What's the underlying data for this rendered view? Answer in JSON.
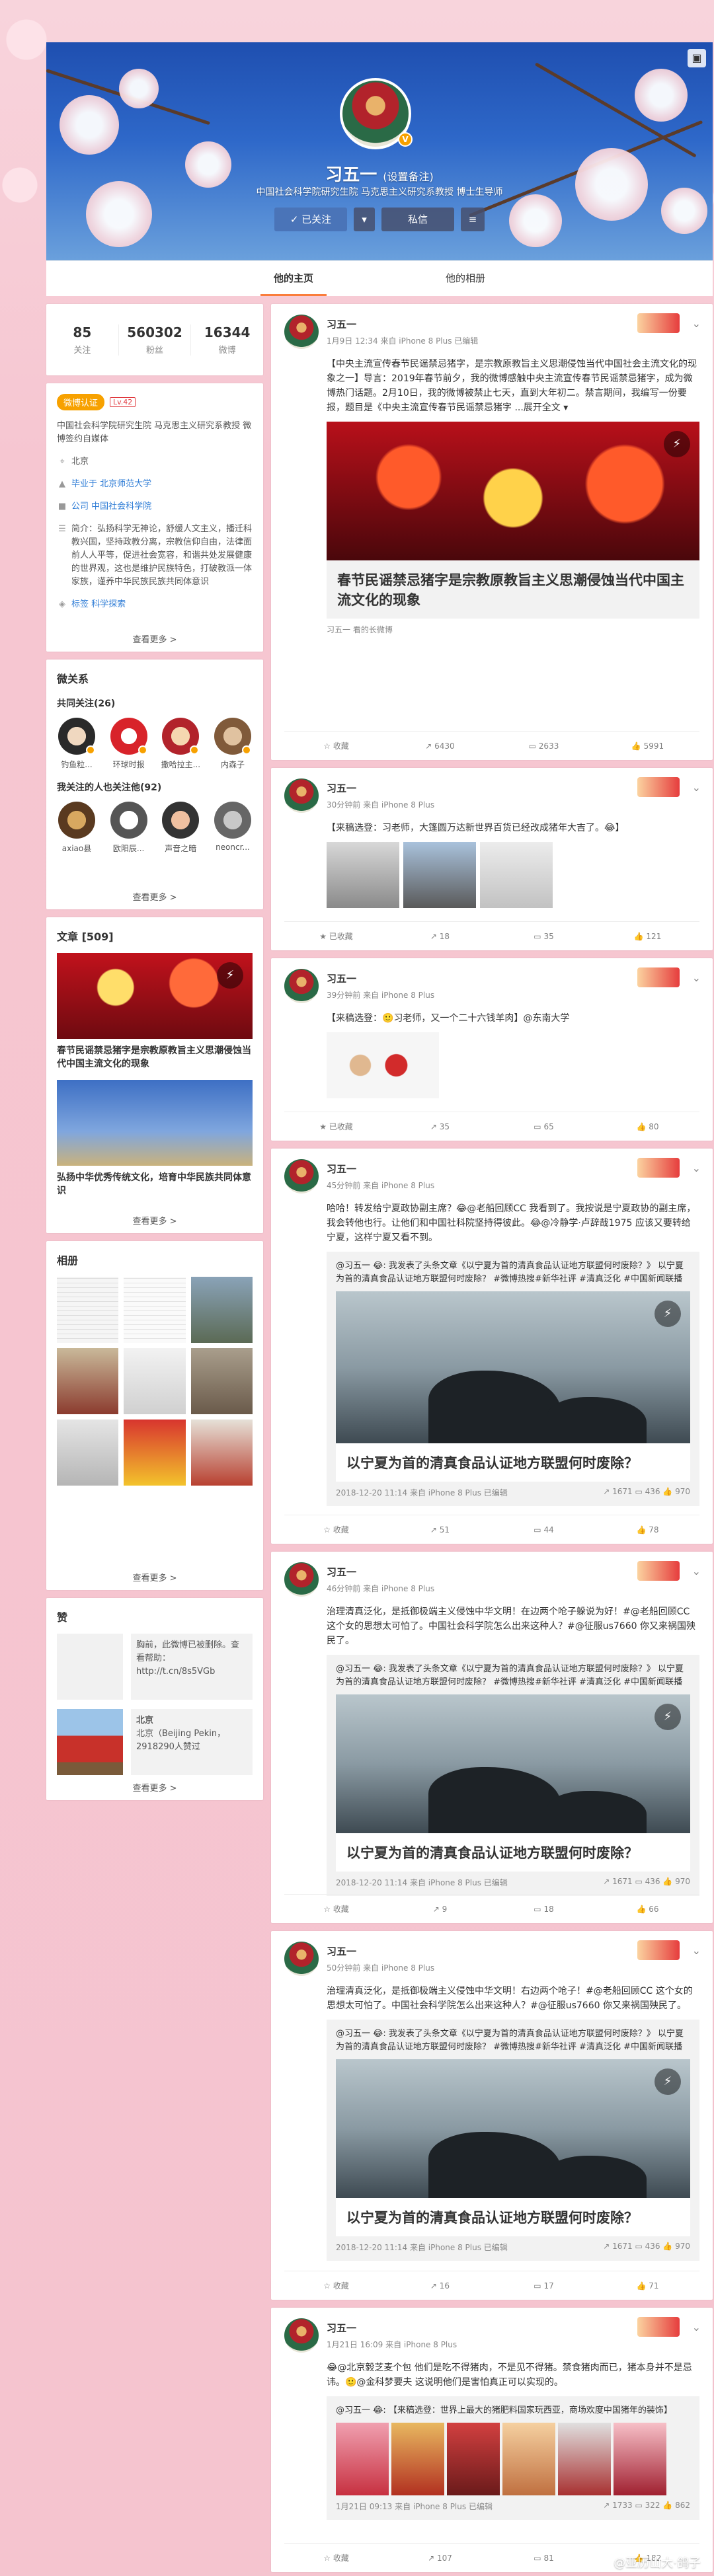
{
  "profile": {
    "name": "习五一",
    "note": "(设置备注)",
    "desc": "中国社会科学院研究生院 马克思主义研究系教授 博士生导师",
    "follow_btn": "已关注",
    "msg_btn": "私信"
  },
  "tabs": [
    "他的主页",
    "他的相册"
  ],
  "stats": [
    {
      "num": "85",
      "label": "关注"
    },
    {
      "num": "560302",
      "label": "粉丝"
    },
    {
      "num": "16344",
      "label": "微博"
    }
  ],
  "info": {
    "vtag": "微博认证",
    "lv": "Lv.42",
    "verify": "中国社会科学院研究生院 马克思主义研究系教授 微博签约自媒体",
    "location": "北京",
    "school": "毕业于 北京师范大学",
    "company": "公司 中国社会科学院",
    "intro": "简介：弘扬科学无神论，舒缓人文主义，播迁科教兴国，坚持政教分离，宗教信仰自由，法律面前人人平等，促进社会宽容，和谐共处发展健康的世界观，这也是维护民族特色，打破教派一体家族，谨养中华民族民族共同体意识",
    "tags": "标签 科学探索",
    "more": "查看更多 >"
  },
  "relations": {
    "title": "微关系",
    "follow_title": "共同关注(26)",
    "follow": [
      "钓鱼粒...",
      "环球时报",
      "撒哈拉主...",
      "内森子"
    ],
    "fans_title": "我关注的人也关注他(92)",
    "fans": [
      "axiao县",
      "欧阳辰...",
      "声音之暗",
      "neoncr..."
    ],
    "more": "查看更多 >"
  },
  "articles": {
    "title": "文章 [509]",
    "items": [
      "春节民谣禁忌猪字是宗教原教旨主义思潮侵蚀当代中国主流文化的现象",
      "弘扬中华优秀传统文化，培育中华民族共同体意识"
    ],
    "more": "查看更多 >"
  },
  "album": {
    "title": "相册",
    "more": "查看更多 >"
  },
  "zan": {
    "title": "赞",
    "item1": "胸前，此微博已被删除。查看帮助：http://t.cn/8s5VGb",
    "item2_title": "北京",
    "item2": "北京（Beijing Pekin，2918290人赞过",
    "more": "查看更多 >"
  },
  "posts": [
    {
      "name": "习五一",
      "meta": "1月9日 12:34 来自 iPhone 8 Plus  已编辑",
      "text": "【中央主流宣传春节民谣禁忌猪字，是宗教原教旨主义思潮侵蚀当代中国社会主流文化的现象之一】导言：2019年春节前夕，我的微博感触中央主流宣传春节民谣禁忌猪字，成为微博热门话题。2月10日，我的微博被禁止七天，直到大年初二。禁言期间，我编写一份要报，题目是《中央主流宣传春节民谣禁忌猪字 ...展开全文 ▾",
      "card_title": "春节民谣禁忌猪字是宗教原教旨主义思潮侵蚀当代中国主流文化的现象",
      "card_meta": "习五一 看的长微博",
      "actions": [
        "收藏",
        "6430",
        "2633",
        "5991"
      ]
    },
    {
      "name": "习五一",
      "meta": "30分钟前 来自 iPhone 8 Plus",
      "text": "【来稿选登：习老师，大篷圆万达新世界百货已经改成猪年大吉了。😂】",
      "actions": [
        "已收藏",
        "18",
        "35",
        "121"
      ]
    },
    {
      "name": "习五一",
      "meta": "39分钟前 来自 iPhone 8 Plus",
      "text": "【来稿选登：🙂习老师，又一个二十六钱羊肉】@东南大学",
      "actions": [
        "已收藏",
        "35",
        "65",
        "80"
      ]
    },
    {
      "name": "习五一",
      "meta": "45分钟前 来自 iPhone 8 Plus",
      "text": "哈哈！转发给宁夏政协副主席？😂@老船回顾CC 我看到了。我按说是宁夏政协的副主席，我会转他也行。让他们和中国社科院坚持得彼此。😂@冷静学·卢辞哉1975 应该又要转给宁夏，这样宁夏又看不到。",
      "fwd_text": "@习五一 😂: 我发表了头条文章《以宁夏为首的清真食品认证地方联盟何时废除？》 以宁夏为首的清真食品认证地方联盟何时废除？ #微博热搜#新华社评 #清真泛化 #中国新闻联播",
      "cap": "以宁夏为首的清真食品认证地方联盟何时废除？",
      "fmeta": "2018-12-20 11:14 来自 iPhone 8 Plus  已编辑",
      "fcounts": [
        "1671",
        "436",
        "970"
      ],
      "actions": [
        "收藏",
        "51",
        "44",
        "78"
      ]
    },
    {
      "name": "习五一",
      "meta": "46分钟前 来自 iPhone 8 Plus",
      "text": "治理清真泛化，是抵御极端主义侵蚀中华文明！在边两个呛子躲说为好！#@老船回顾CC 这个女的思想太可怕了。中国社会科学院怎么出来这种人？#@征服us7660 你又来祸国殃民了。",
      "fwd_text": "@习五一 😂: 我发表了头条文章《以宁夏为首的清真食品认证地方联盟何时废除？》 以宁夏为首的清真食品认证地方联盟何时废除？ #微博热搜#新华社评 #清真泛化 #中国新闻联播",
      "cap": "以宁夏为首的清真食品认证地方联盟何时废除？",
      "fmeta": "2018-12-20 11:14 来自 iPhone 8 Plus  已编辑",
      "fcounts": [
        "1671",
        "436",
        "970"
      ],
      "actions": [
        "收藏",
        "9",
        "18",
        "66"
      ]
    },
    {
      "name": "习五一",
      "meta": "50分钟前 来自 iPhone 8 Plus",
      "text": "治理清真泛化，是抵御极端主义侵蚀中华文明！右边两个呛子！#@老船回顾CC 这个女的思想太可怕了。中国社会科学院怎么出来这种人？#@征服us7660 你又来祸国殃民了。",
      "fwd_text": "@习五一 😂: 我发表了头条文章《以宁夏为首的清真食品认证地方联盟何时废除？》 以宁夏为首的清真食品认证地方联盟何时废除？ #微博热搜#新华社评 #清真泛化 #中国新闻联播",
      "cap": "以宁夏为首的清真食品认证地方联盟何时废除？",
      "fmeta": "2018-12-20 11:14 来自 iPhone 8 Plus  已编辑",
      "fcounts": [
        "1671",
        "436",
        "970"
      ],
      "actions": [
        "收藏",
        "16",
        "17",
        "71"
      ]
    },
    {
      "name": "习五一",
      "meta": "1月21日 16:09 来自 iPhone 8 Plus",
      "text": "😂@北京毅芝麦个包 他们是吃不得猪肉，不是见不得猪。禁食猪肉而已，猪本身并不是忌讳。🙂@金科梦要夫 这说明他们是害怕真正可以实现的。",
      "fwd_text": "@习五一 😂: 【来稿选登：世界上最大的猪肥料国家玩西亚，商场欢度中国猪年的装饰】",
      "fmeta": "1月21日 09:13 来自 iPhone 8 Plus  已编辑",
      "fcounts": [
        "1733",
        "322",
        "862"
      ],
      "actions": [
        "收藏",
        "107",
        "81",
        "182"
      ]
    }
  ],
  "watermark": "@亚历山大·鸽子"
}
